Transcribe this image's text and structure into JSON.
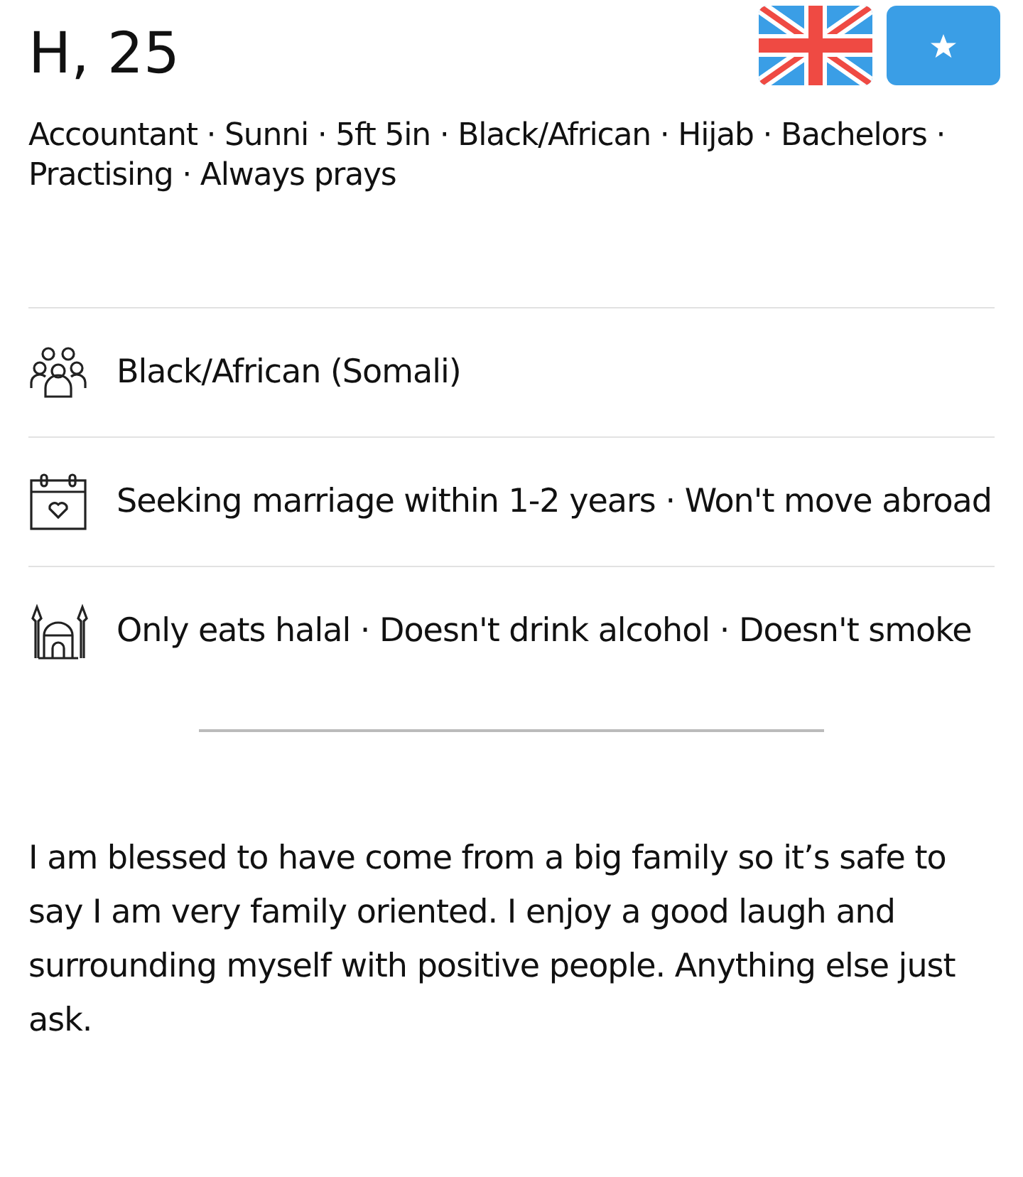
{
  "header": {
    "title": "H, 25",
    "flags": [
      {
        "kind": "uk"
      },
      {
        "kind": "somalia"
      }
    ]
  },
  "summary": "Accountant · Sunni · 5ft 5in · Black/African · Hijab · Bachelors · Practising · Always prays",
  "details": [
    {
      "kind": "people",
      "text": "Black/African (Somali)"
    },
    {
      "kind": "calendar",
      "text": "Seeking marriage within 1-2 years · Won't move abroad"
    },
    {
      "kind": "mosque",
      "text": "Only eats halal · Doesn't drink alcohol · Doesn't smoke"
    }
  ],
  "bio": "I am blessed to have come from a big family so it’s safe to say I am very family oriented. I enjoy a good laugh and surrounding myself with positive people. Anything else just ask."
}
